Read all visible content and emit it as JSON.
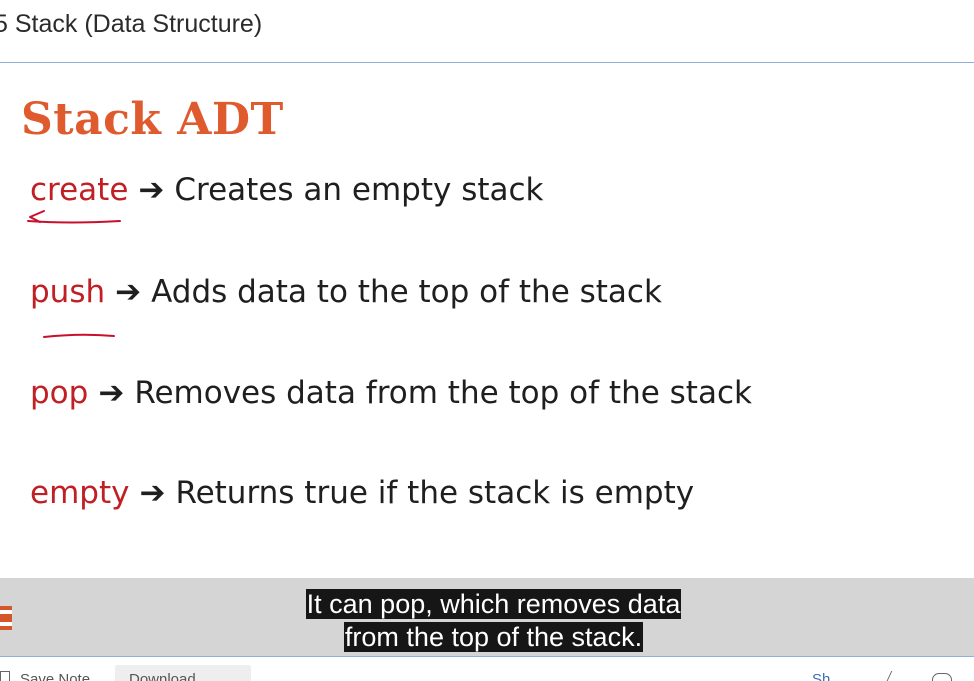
{
  "window": {
    "title": "5 Stack (Data Structure)"
  },
  "slide": {
    "title": "Stack ADT",
    "arrow": "➔",
    "operations": [
      {
        "name": "create",
        "description": "Creates an empty stack"
      },
      {
        "name": "push",
        "description": "Adds data to the top of the stack"
      },
      {
        "name": "pop",
        "description": "Removes data from the top of the stack"
      },
      {
        "name": "empty",
        "description": "Returns true if the stack is empty"
      }
    ]
  },
  "captions": {
    "line1": "It can pop, which removes data",
    "line2": "from the top of the stack."
  },
  "toolbar": {
    "save_note_label": "Save Note",
    "download_label": "Download",
    "share_label": "Sh"
  },
  "colors": {
    "slide_title": "#df5a2d",
    "operation_name": "#c01f24",
    "annotation_ink": "#c8102e",
    "caption_bg": "#161616",
    "caption_band": "#d5d5d5"
  }
}
